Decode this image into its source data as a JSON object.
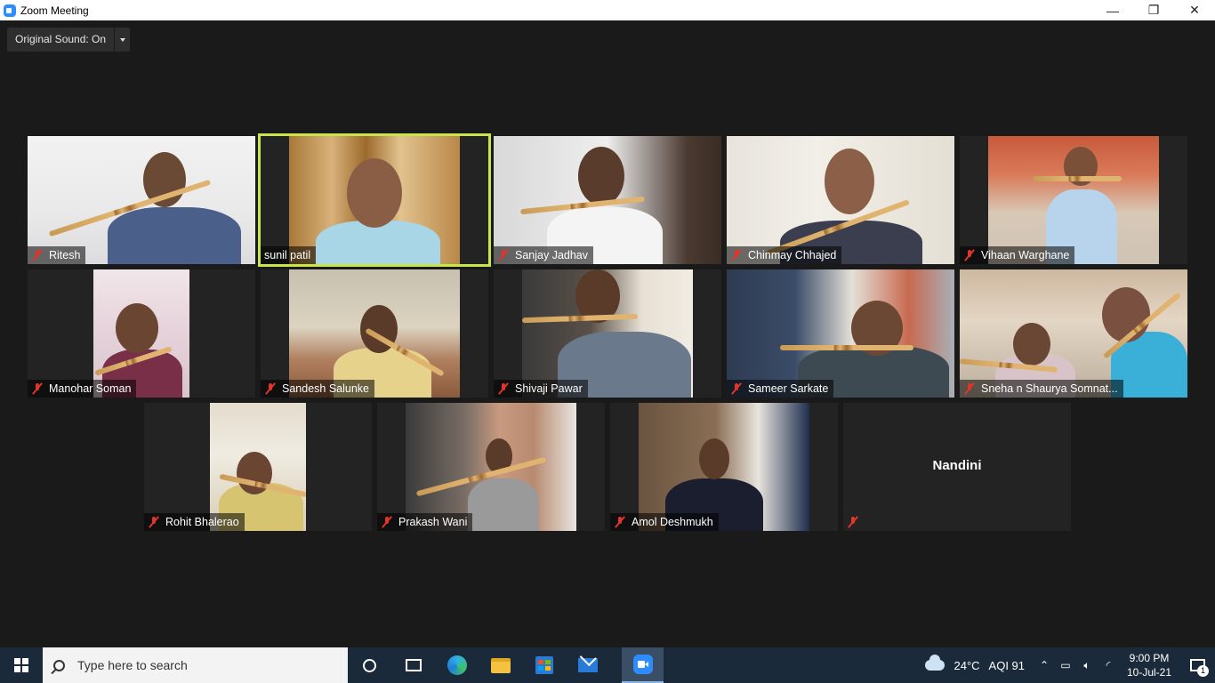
{
  "window": {
    "title": "Zoom Meeting",
    "minimize": "—",
    "maximize": "❐",
    "close": "✕"
  },
  "original_sound": {
    "label": "Original Sound: On"
  },
  "participants": [
    {
      "name": "Ritesh"
    },
    {
      "name": "sunil patil"
    },
    {
      "name": "Sanjay Jadhav"
    },
    {
      "name": "Chinmay Chhajed"
    },
    {
      "name": "Vihaan Warghane"
    },
    {
      "name": "Manohar Soman"
    },
    {
      "name": "Sandesh Salunke"
    },
    {
      "name": "Shivaji Pawar"
    },
    {
      "name": "Sameer Sarkate"
    },
    {
      "name": "Sneha n Shaurya Somnat..."
    },
    {
      "name": "Rohit Bhalerao"
    },
    {
      "name": "Prakash Wani"
    },
    {
      "name": "Amol Deshmukh"
    },
    {
      "name": "Nandini"
    }
  ],
  "active_speaker": "sunil patil",
  "taskbar": {
    "search_placeholder": "Type here to search",
    "weather": "24°C",
    "aqi": "AQI 91",
    "time": "9:00 PM",
    "date": "10-Jul-21",
    "notification_count": "1"
  },
  "colors": {
    "active_outline": "#c8e64c",
    "mic_muted": "#e0352b",
    "zoom_blue": "#2d8cff"
  }
}
